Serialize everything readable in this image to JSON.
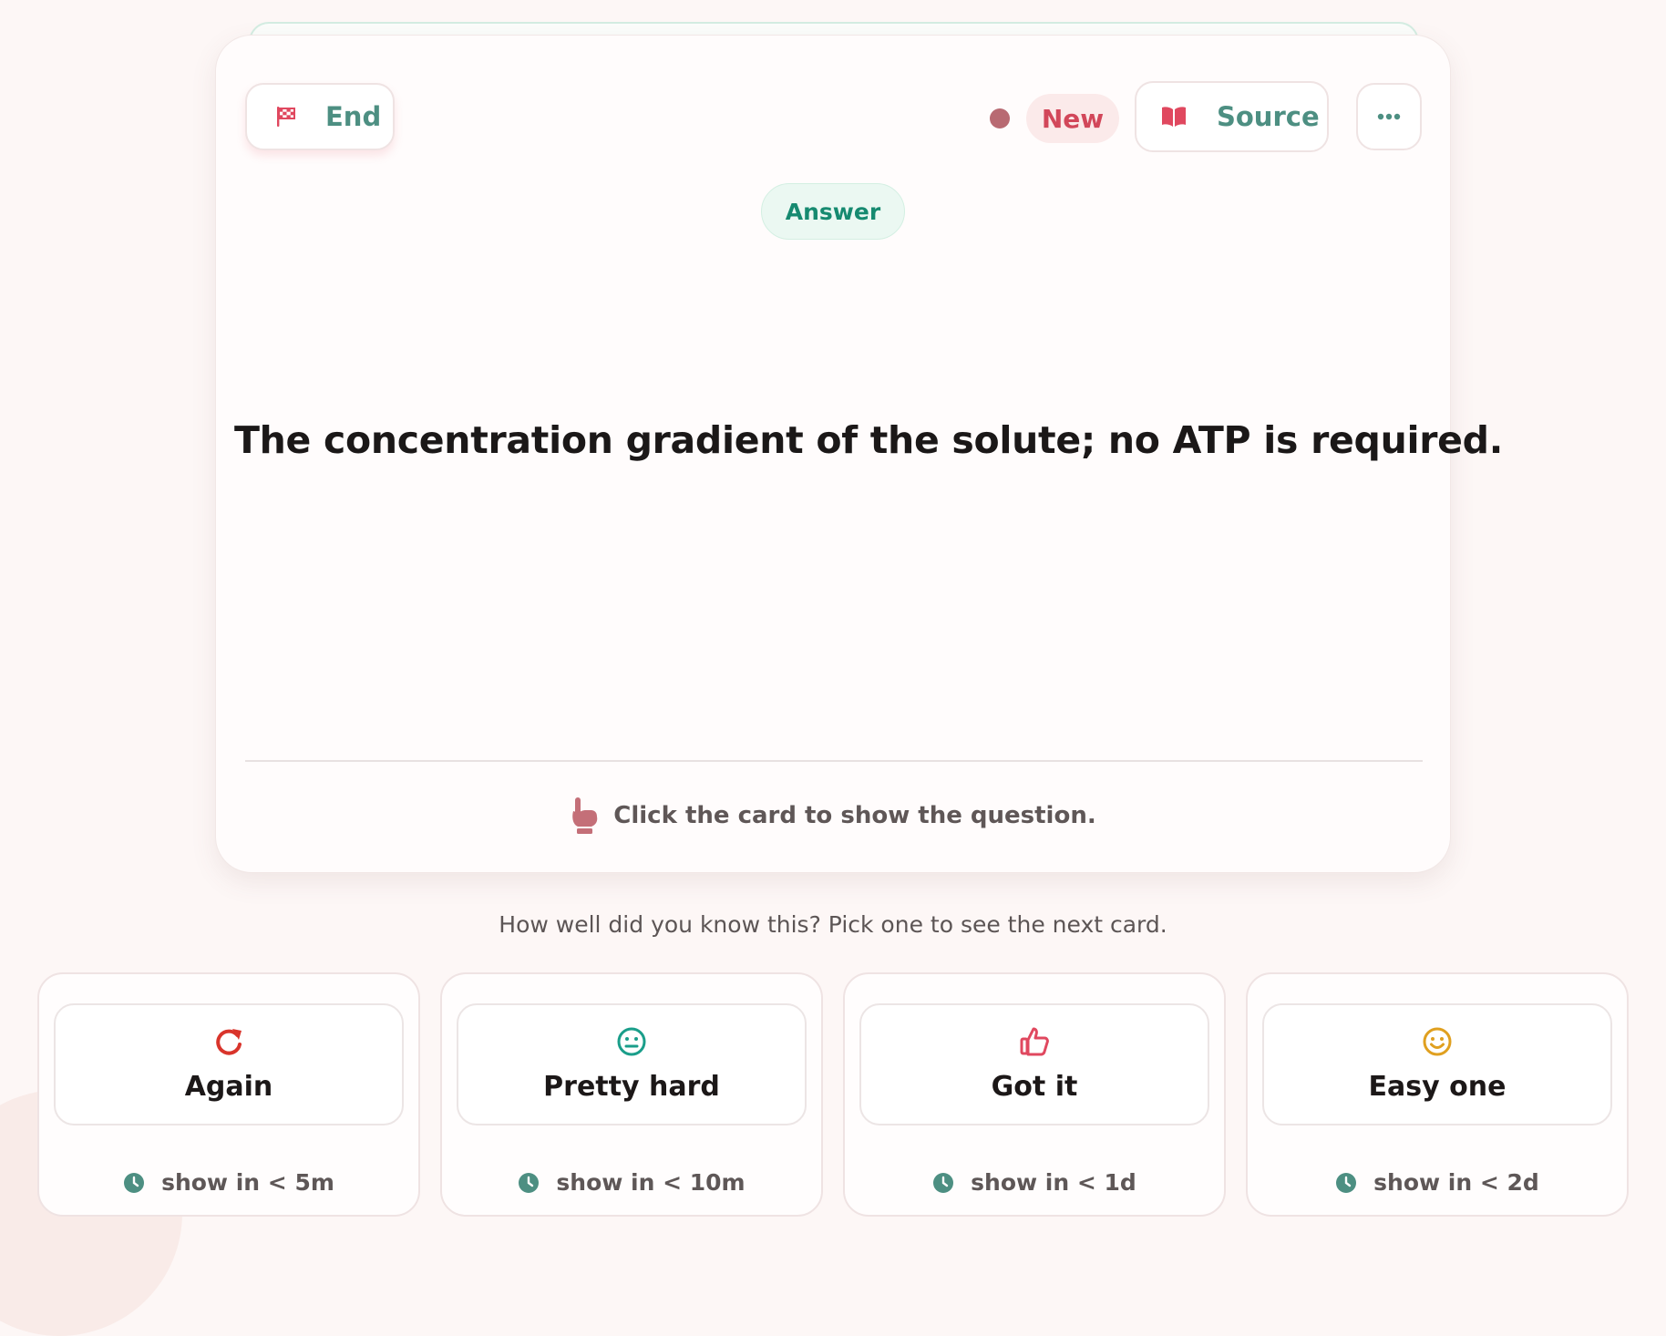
{
  "header": {
    "end_label": "End",
    "status_badge": "New",
    "source_label": "Source"
  },
  "card": {
    "side_badge": "Answer",
    "answer_text": "The concentration gradient of the solute; no ATP is required.",
    "hint": "Click the card to show the question."
  },
  "rating": {
    "prompt": "How well did you know this? Pick one to see the next card.",
    "options": [
      {
        "label": "Again",
        "interval": "show in < 5m",
        "icon": "retry-icon",
        "color": "#d9342b"
      },
      {
        "label": "Pretty hard",
        "interval": "show in < 10m",
        "icon": "neutral-face-icon",
        "color": "#1a9e8a"
      },
      {
        "label": "Got it",
        "interval": "show in < 1d",
        "icon": "thumbs-up-icon",
        "color": "#e0485f"
      },
      {
        "label": "Easy one",
        "interval": "show in < 2d",
        "icon": "smile-face-icon",
        "color": "#e0a020"
      }
    ]
  },
  "colors": {
    "accent_teal": "#4d8f82",
    "accent_red": "#d2475a",
    "status_dot": "#b86a72",
    "background": "#fdf7f6"
  }
}
